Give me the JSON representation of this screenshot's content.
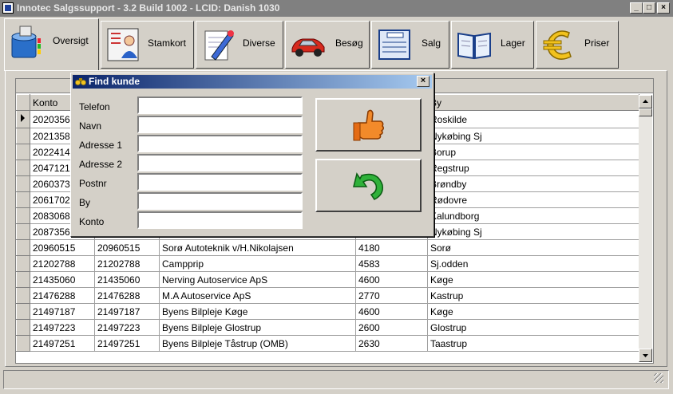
{
  "window": {
    "title": "Innotec Salgssupport -  3.2 Build 1002 - LCID: Danish 1030",
    "controls": {
      "minimize": "_",
      "maximize": "□",
      "close": "×"
    }
  },
  "tabs": [
    {
      "label": "Oversigt",
      "icon": "database-icon",
      "active": true
    },
    {
      "label": "Stamkort",
      "icon": "contact-card-icon"
    },
    {
      "label": "Diverse",
      "icon": "notepad-pen-icon"
    },
    {
      "label": "Besøg",
      "icon": "car-icon"
    },
    {
      "label": "Salg",
      "icon": "invoice-icon"
    },
    {
      "label": "Lager",
      "icon": "book-icon"
    },
    {
      "label": "Priser",
      "icon": "euro-icon"
    }
  ],
  "grid": {
    "columns": [
      "Konto",
      "",
      "",
      "",
      "By"
    ],
    "rows": [
      {
        "k1": "2020356",
        "k2": "",
        "name": "",
        "zip": "",
        "city": "Roskilde",
        "current": true
      },
      {
        "k1": "2021358",
        "k2": "",
        "name": "",
        "zip": "",
        "city": "Nykøbing Sj"
      },
      {
        "k1": "2022414",
        "k2": "",
        "name": "",
        "zip": "",
        "city": "Borup"
      },
      {
        "k1": "2047121",
        "k2": "",
        "name": "",
        "zip": "",
        "city": "Regstrup"
      },
      {
        "k1": "2060373",
        "k2": "",
        "name": "",
        "zip": "",
        "city": "Brøndby"
      },
      {
        "k1": "2061702",
        "k2": "",
        "name": "",
        "zip": "",
        "city": "Rødovre"
      },
      {
        "k1": "2083068",
        "k2": "",
        "name": "",
        "zip": "",
        "city": "Kalundborg"
      },
      {
        "k1": "2087356",
        "k2": "",
        "name": "",
        "zip": "",
        "city": "Nykøbing Sj"
      },
      {
        "k1": "20960515",
        "k2": "20960515",
        "name": "Sorø Autoteknik v/H.Nikolajsen",
        "zip": "4180",
        "city": "Sorø"
      },
      {
        "k1": "21202788",
        "k2": "21202788",
        "name": "Campprip",
        "zip": "4583",
        "city": "Sj.odden"
      },
      {
        "k1": "21435060",
        "k2": "21435060",
        "name": "Nerving Autoservice ApS",
        "zip": "4600",
        "city": "Køge"
      },
      {
        "k1": "21476288",
        "k2": "21476288",
        "name": "M.A Autoservice ApS",
        "zip": "2770",
        "city": "Kastrup"
      },
      {
        "k1": "21497187",
        "k2": "21497187",
        "name": "Byens Bilpleje Køge",
        "zip": "4600",
        "city": "Køge"
      },
      {
        "k1": "21497223",
        "k2": "21497223",
        "name": "Byens Bilpleje Glostrup",
        "zip": "2600",
        "city": "Glostrup"
      },
      {
        "k1": "21497251",
        "k2": "21497251",
        "name": "Byens Bilpleje Tåstrup (OMB)",
        "zip": "2630",
        "city": "Taastrup"
      }
    ]
  },
  "dialog": {
    "title": "Find kunde",
    "fields": [
      {
        "label": "Telefon",
        "value": ""
      },
      {
        "label": "Navn",
        "value": ""
      },
      {
        "label": "Adresse 1",
        "value": ""
      },
      {
        "label": "Adresse 2",
        "value": ""
      },
      {
        "label": "Postnr",
        "value": ""
      },
      {
        "label": "By",
        "value": ""
      },
      {
        "label": "Konto",
        "value": ""
      }
    ],
    "ok_icon": "thumbs-up-icon",
    "cancel_icon": "undo-arrow-icon"
  }
}
